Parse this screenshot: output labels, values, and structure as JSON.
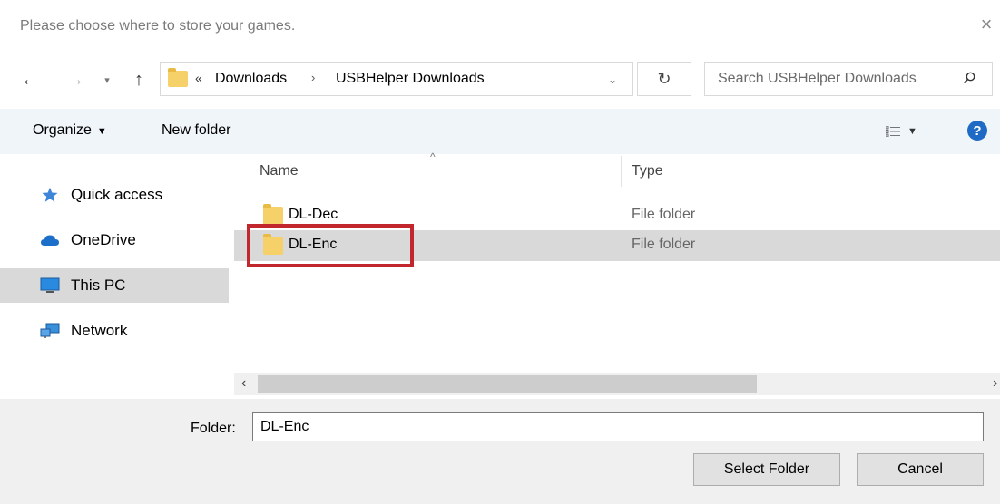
{
  "dialog": {
    "title": "Please choose where to store your games.",
    "close_glyph": "×"
  },
  "address": {
    "chevron": "«",
    "breadcrumbs": [
      "Downloads",
      "USBHelper Downloads"
    ],
    "separator": "›"
  },
  "search": {
    "placeholder": "Search USBHelper Downloads"
  },
  "toolbar": {
    "organize_label": "Organize",
    "newfolder_label": "New folder",
    "help_label": "?"
  },
  "nav": {
    "items": [
      {
        "label": "Quick access",
        "icon": "star-icon"
      },
      {
        "label": "OneDrive",
        "icon": "cloud-icon"
      },
      {
        "label": "This PC",
        "icon": "computer-icon",
        "selected": true
      },
      {
        "label": "Network",
        "icon": "network-icon"
      }
    ]
  },
  "files": {
    "columns": {
      "name": "Name",
      "type": "Type"
    },
    "rows": [
      {
        "name": "DL-Dec",
        "type": "File folder",
        "selected": false
      },
      {
        "name": "DL-Enc",
        "type": "File folder",
        "selected": true
      }
    ]
  },
  "folder_field": {
    "label": "Folder:",
    "value": "DL-Enc"
  },
  "buttons": {
    "select": "Select Folder",
    "cancel": "Cancel"
  },
  "colors": {
    "highlight_box": "#c1272d",
    "folder_yellow": "#f6d16a",
    "help_blue": "#1e6ac5",
    "toolbar_bg": "#f0f5fa"
  }
}
